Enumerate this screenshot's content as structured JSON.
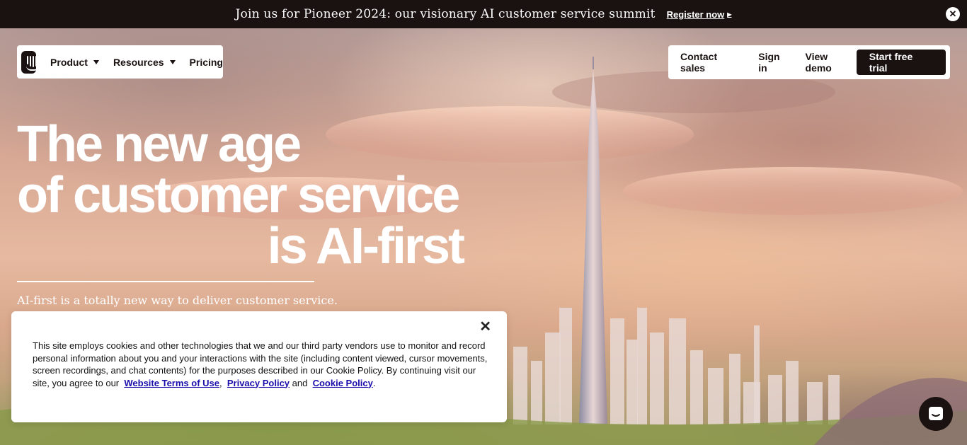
{
  "announcement": {
    "text": "Join us for Pioneer 2024: our visionary AI customer service summit",
    "link_label": "Register now",
    "close_icon": "close-icon"
  },
  "nav": {
    "logo_icon": "intercom-logo-icon",
    "left_items": [
      {
        "label": "Product",
        "has_dropdown": true
      },
      {
        "label": "Resources",
        "has_dropdown": true
      },
      {
        "label": "Pricing",
        "has_dropdown": false
      }
    ],
    "right_items": [
      {
        "label": "Contact sales"
      },
      {
        "label": "Sign in"
      },
      {
        "label": "View demo"
      }
    ],
    "cta_label": "Start free trial"
  },
  "hero": {
    "headline_line1": "The new age",
    "headline_line2": "of customer service",
    "headline_line3": "is AI-first",
    "subheading": "AI-first is a totally new way to deliver customer service."
  },
  "cookie_banner": {
    "text_before": "This site employs cookies and other technologies that we and our third party vendors use to monitor and record personal information about you and your interactions with the site (including content viewed, cursor movements, screen recordings, and chat contents) for the purposes described in our Cookie Policy. By continuing visit our site, you agree to our",
    "link_terms": "Website Terms of Use",
    "sep1": ",",
    "link_privacy": "Privacy Policy",
    "conj": "and",
    "link_cookie": "Cookie Policy",
    "end": ".",
    "close_icon": "close-icon"
  },
  "messenger": {
    "icon": "chat-bubble-icon"
  },
  "colors": {
    "dark": "#1a1111",
    "link": "#1a0dab",
    "white": "#ffffff"
  }
}
